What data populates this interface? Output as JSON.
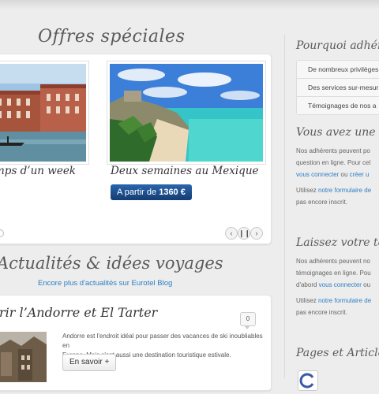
{
  "offers": {
    "heading": "Offres spéciales",
    "items": [
      {
        "title": "mps d’un week",
        "price_prefix": "",
        "price_value": ""
      },
      {
        "title": "Deux semaines au Mexique",
        "price_prefix": "A partir de",
        "price_value": "1360 €"
      }
    ],
    "controls": {
      "prev": "‹",
      "pause": "❙❙",
      "next": "›"
    }
  },
  "news": {
    "heading": "Actualités & idées voyages",
    "blog_link": "Encore plus d'actualités sur Eurotel Blog",
    "article": {
      "title": "rir l’Andorre et El Tarter",
      "comments": "0",
      "text_line1": "Andorre est l'endroit idéal pour passer des vacances de ski inoubliables en",
      "text_line2": "Europe. Mais c'est aussi une destination touristique estivale.",
      "more": "En savoir +"
    }
  },
  "sidebar": {
    "why_heading": "Pourquoi adhér",
    "why_items": [
      "De nombreux privilèges",
      "Des services sur-mesur",
      "Témoignages de nos a"
    ],
    "question_heading": "Vous avez une q",
    "question_p1_l1": "Nos adhérents peuvent po",
    "question_p1_l2": "question en ligne. Pour cel",
    "question_link1": "vous connecter",
    "question_mid": " ou ",
    "question_link2": "créer u",
    "question_p2_prefix": "Utilisez ",
    "question_p2_link": "notre formulaire de",
    "question_p2_l2": "pas encore inscrit.",
    "testimony_heading": "Laissez votre té",
    "testimony_p1_l1": "Nos adhérents peuvent no",
    "testimony_p1_l2": "témoignages en ligne. Pou",
    "testimony_p1_l3_prefix": "d'abord ",
    "testimony_link1": "vous connecter",
    "testimony_p1_l3_suffix": " ou",
    "testimony_p2_prefix": "Utilisez ",
    "testimony_p2_link": "notre formulaire de",
    "testimony_p2_l2": "pas encore inscrit.",
    "pages_heading": "Pages et Articles"
  },
  "colors": {
    "accent_link": "#2d7ec4",
    "price_button": "#1d4f8f",
    "background": "#ededed"
  }
}
